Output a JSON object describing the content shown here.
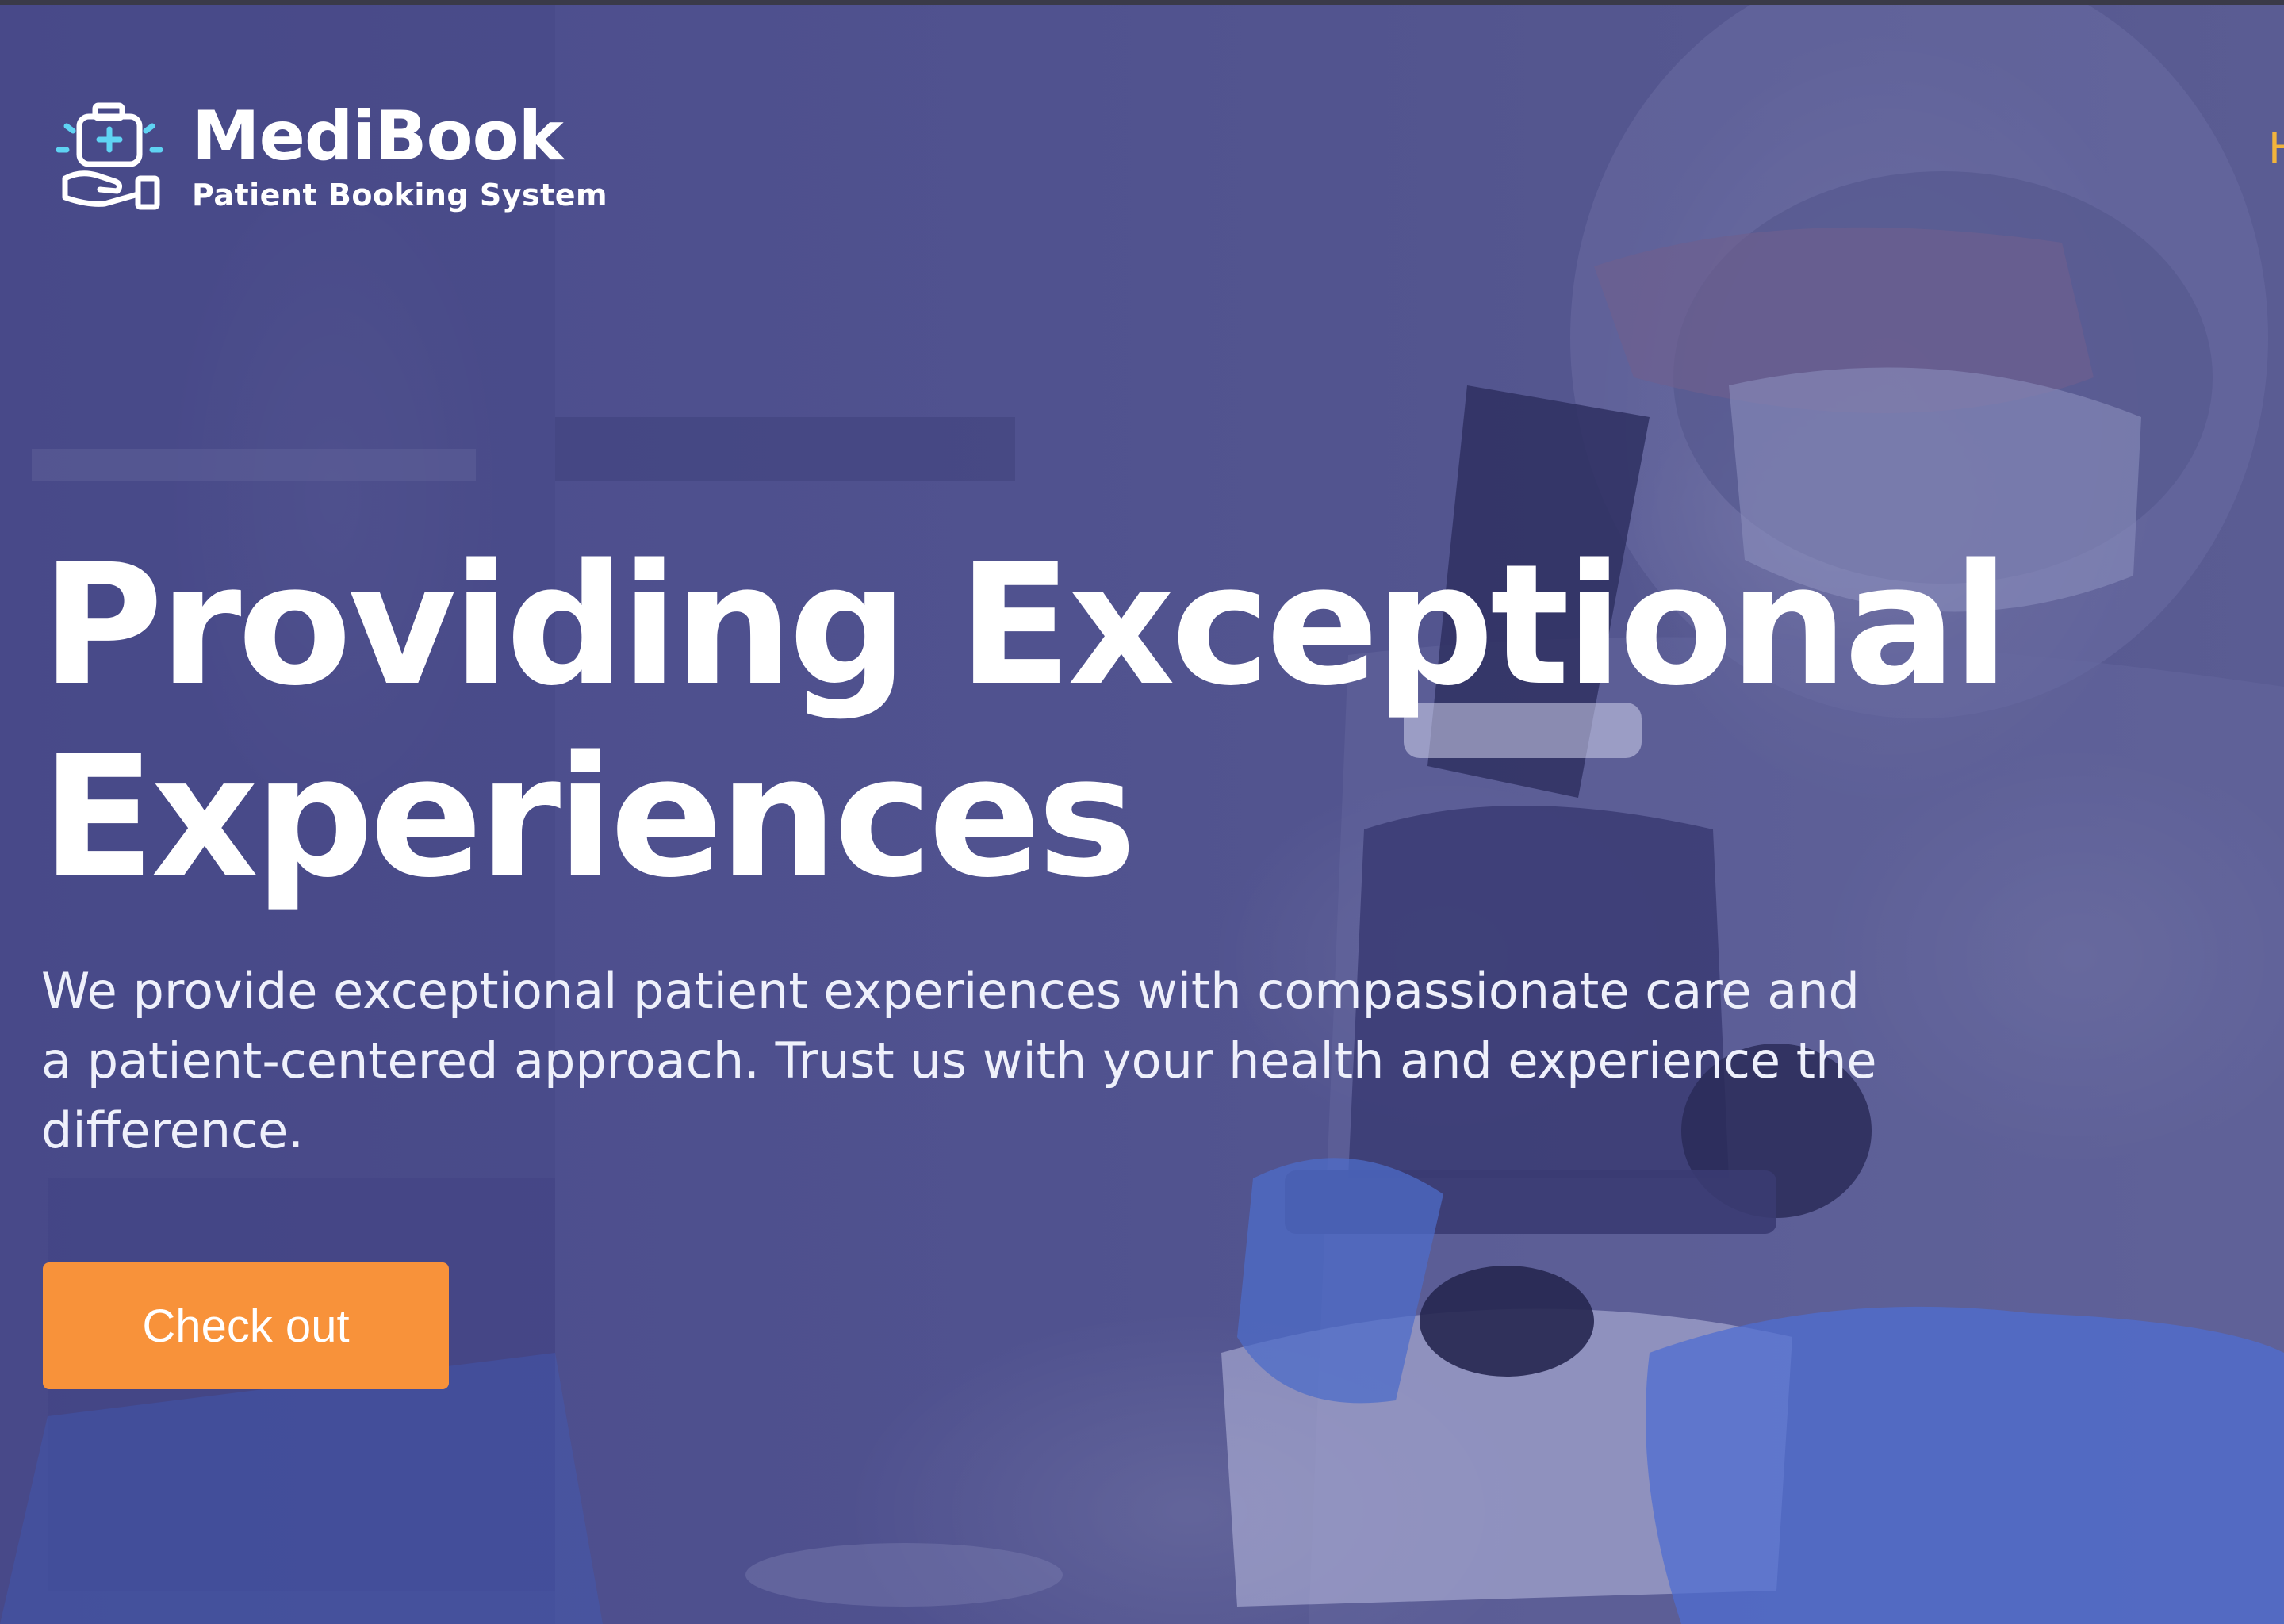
{
  "brand": {
    "name": "MediBook",
    "tagline": "Patient Booking System",
    "icon": "medical-kit-hand-icon"
  },
  "nav": {
    "link_label": "H"
  },
  "hero": {
    "headline": "Providing Exceptional Experiences",
    "subtext": "We provide exceptional patient experiences with compassionate care and a patient-centered approach. Trust us with your health and experience the difference.",
    "cta_label": "Check out"
  },
  "colors": {
    "overlay": "#4a4b8c",
    "accent_orange": "#f8923a",
    "nav_link": "#f2b43c",
    "text": "#ffffff"
  }
}
